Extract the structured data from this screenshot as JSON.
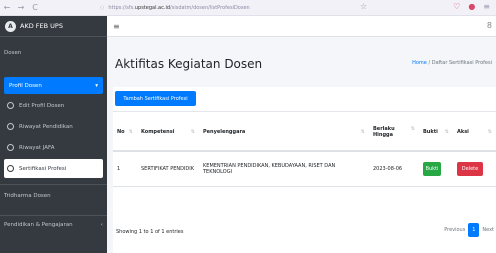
{
  "browser": {
    "back_icon": "←",
    "forward_icon": "→",
    "reload_icon": "C",
    "shield_icon": "◌",
    "url_prefix": "https://sfs.",
    "url_domain": "upstegal.ac.id",
    "url_path": "/sisdatm/dosen/listProfesiDosen",
    "star_icon": "☆",
    "pocket_icon": "♡",
    "download_icon": "●",
    "menu_icon": "≡"
  },
  "sidebar": {
    "brand_logo": "A",
    "brand": "AKD FEB UPS",
    "section_label": "Dosen",
    "active_menu": "Profil Dosen",
    "active_chevron": "▾",
    "sub_items": [
      {
        "label": "Edit Profil Dosen"
      },
      {
        "label": "Riwayat Pendidikan"
      },
      {
        "label": "Riwayat JAFA"
      },
      {
        "label": "Sertifikasi Profesi"
      }
    ],
    "tridharma": "Tridharma Dosen",
    "pendidikan": "Pendidikan & Pengajaran",
    "pendidikan_chevron": "‹"
  },
  "topbar": {
    "hamburger": "≡",
    "user_icon": "8"
  },
  "page": {
    "title": "Aktifitas Kegiatan Dosen",
    "breadcrumb_home": "Home",
    "breadcrumb_sep": "/",
    "breadcrumb_current": "Daftar Sertifikasi Profesi"
  },
  "card": {
    "add_button": "Tambah Sertifikasi Profesi"
  },
  "table": {
    "headers": [
      "No",
      "Kompetensi",
      "Penyelenggara",
      "Berlaku Hingga",
      "Bukti",
      "Aksi"
    ],
    "rows": [
      {
        "no": "1",
        "kompetensi": "SERTIFIKAT PENDIDIK",
        "penyelenggara": "KEMENTRIAN PENDIDIKAN, KEBUDAYAAN, RISET DAN TEKNOLOGI",
        "berlaku": "2023-08-06",
        "bukti": "Bukti",
        "aksi": "Delete"
      }
    ]
  },
  "footer": {
    "showing": "Showing 1 to 1 of 1 entries",
    "previous": "Previous",
    "current_page": "1",
    "next": "Next"
  }
}
